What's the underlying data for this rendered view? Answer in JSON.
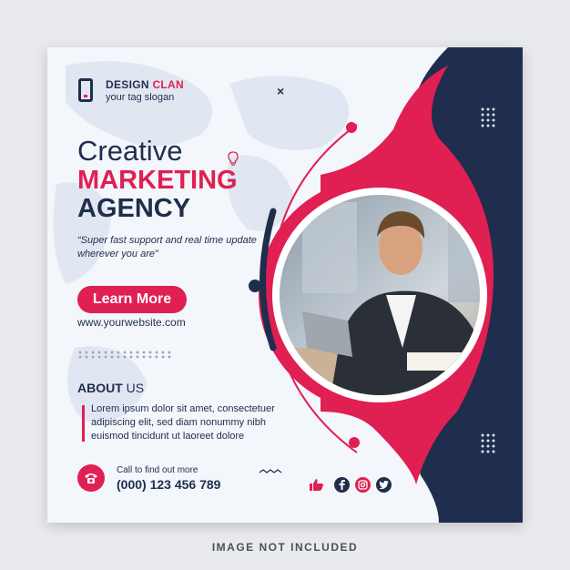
{
  "brand": {
    "name_a": "DESIGN",
    "name_b": "CLAN",
    "slogan": "your tag slogan"
  },
  "headline": {
    "line1": "Creative",
    "line2": "MARKETING",
    "line3": "AGENCY"
  },
  "quote": "“Super fast support and real time update wherever you are”",
  "cta": {
    "label": "Learn More"
  },
  "website": "www.yourwebsite.com",
  "about": {
    "title": "ABOUT",
    "title_suffix": "US",
    "body": "Lorem ipsum dolor sit amet, consectetuer adipiscing elit, sed diam nonummy nibh euismod tincidunt ut laoreet dolore"
  },
  "contact": {
    "label": "Call to find out more",
    "phone": "(000) 123 456 789"
  },
  "close_glyph": "×",
  "footer_note": "IMAGE NOT INCLUDED",
  "icons": [
    "phone-icon",
    "thumbs-up-icon",
    "facebook-icon",
    "instagram-icon",
    "twitter-icon",
    "lightbulb-icon",
    "close-icon"
  ],
  "colors": {
    "navy": "#1f2e4d",
    "pink": "#e01f53",
    "background": "#f3f6fb"
  }
}
